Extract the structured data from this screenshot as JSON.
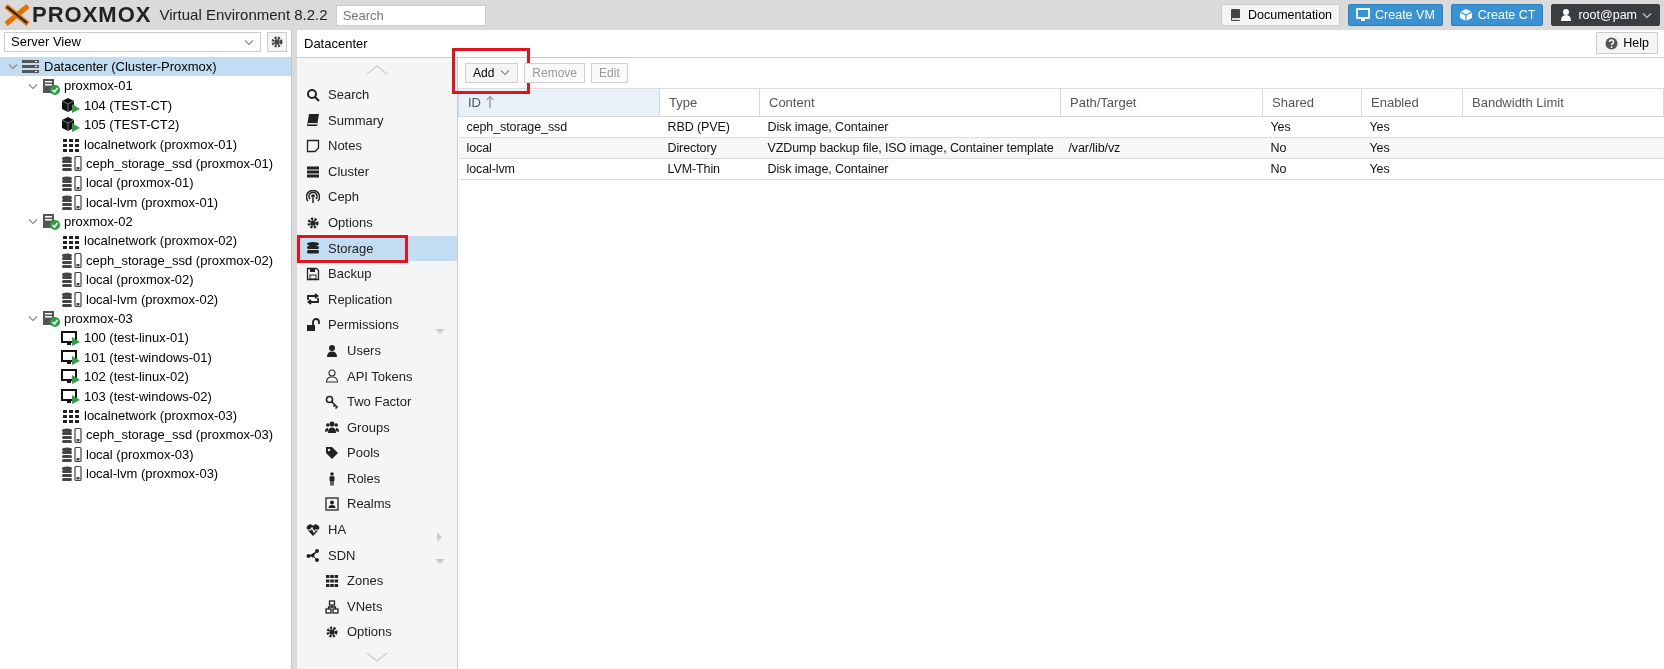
{
  "topbar": {
    "logo": "PROXMOX",
    "product": "Virtual Environment 8.2.2",
    "search": {
      "placeholder": "Search"
    },
    "buttons": [
      {
        "label": "Documentation",
        "kind": "doc"
      },
      {
        "label": "Create VM",
        "kind": "vm"
      },
      {
        "label": "Create CT",
        "kind": "ct"
      },
      {
        "label": "root@pam",
        "kind": "user"
      }
    ]
  },
  "sidebar": {
    "view": "Server View",
    "tree": [
      {
        "label": "Datacenter (Cluster-Proxmox)",
        "kind": "datacenter",
        "selected": true,
        "expanded": true,
        "children": [
          {
            "label": "proxmox-01",
            "kind": "node",
            "selected": false,
            "expanded": true,
            "children": [
              {
                "label": "104 (TEST-CT)",
                "kind": "ct",
                "selected": false
              },
              {
                "label": "105 (TEST-CT2)",
                "kind": "ct",
                "selected": false
              },
              {
                "label": "localnetwork (proxmox-01)",
                "kind": "network",
                "selected": false
              },
              {
                "label": "ceph_storage_ssd (proxmox-01)",
                "kind": "storage",
                "selected": false
              },
              {
                "label": "local (proxmox-01)",
                "kind": "storage",
                "selected": false
              },
              {
                "label": "local-lvm (proxmox-01)",
                "kind": "storage",
                "selected": false
              }
            ]
          },
          {
            "label": "proxmox-02",
            "kind": "node",
            "selected": false,
            "expanded": true,
            "children": [
              {
                "label": "localnetwork (proxmox-02)",
                "kind": "network",
                "selected": false
              },
              {
                "label": "ceph_storage_ssd (proxmox-02)",
                "kind": "storage",
                "selected": false
              },
              {
                "label": "local (proxmox-02)",
                "kind": "storage",
                "selected": false
              },
              {
                "label": "local-lvm (proxmox-02)",
                "kind": "storage",
                "selected": false
              }
            ]
          },
          {
            "label": "proxmox-03",
            "kind": "node",
            "selected": false,
            "expanded": true,
            "children": [
              {
                "label": "100 (test-linux-01)",
                "kind": "vm",
                "selected": false
              },
              {
                "label": "101 (test-windows-01)",
                "kind": "vm",
                "selected": false
              },
              {
                "label": "102 (test-linux-02)",
                "kind": "vm",
                "selected": false
              },
              {
                "label": "103 (test-windows-02)",
                "kind": "vm",
                "selected": false
              },
              {
                "label": "localnetwork (proxmox-03)",
                "kind": "network",
                "selected": false
              },
              {
                "label": "ceph_storage_ssd (proxmox-03)",
                "kind": "storage",
                "selected": false
              },
              {
                "label": "local (proxmox-03)",
                "kind": "storage",
                "selected": false
              },
              {
                "label": "local-lvm (proxmox-03)",
                "kind": "storage",
                "selected": false
              }
            ]
          }
        ]
      }
    ]
  },
  "main": {
    "title": "Datacenter",
    "help": "Help",
    "menu": [
      {
        "label": "Search",
        "selected": false,
        "highlighted": false
      },
      {
        "label": "Summary",
        "selected": false,
        "highlighted": false
      },
      {
        "label": "Notes",
        "selected": false,
        "highlighted": false
      },
      {
        "label": "Cluster",
        "selected": false,
        "highlighted": false
      },
      {
        "label": "Ceph",
        "selected": false,
        "highlighted": false
      },
      {
        "label": "Options",
        "selected": false,
        "highlighted": false
      },
      {
        "label": "Storage",
        "selected": true,
        "highlighted": true
      },
      {
        "label": "Backup",
        "selected": false,
        "highlighted": false
      },
      {
        "label": "Replication",
        "selected": false,
        "highlighted": false
      },
      {
        "label": "Permissions",
        "selected": false,
        "highlighted": false,
        "expanded": true,
        "children": [
          {
            "label": "Users",
            "selected": false,
            "highlighted": false
          },
          {
            "label": "API Tokens",
            "selected": false,
            "highlighted": false
          },
          {
            "label": "Two Factor",
            "selected": false,
            "highlighted": false
          },
          {
            "label": "Groups",
            "selected": false,
            "highlighted": false
          },
          {
            "label": "Pools",
            "selected": false,
            "highlighted": false
          },
          {
            "label": "Roles",
            "selected": false,
            "highlighted": false
          },
          {
            "label": "Realms",
            "selected": false,
            "highlighted": false
          }
        ]
      },
      {
        "label": "HA",
        "selected": false,
        "highlighted": false,
        "expanded": false
      },
      {
        "label": "SDN",
        "selected": false,
        "highlighted": false,
        "expanded": true,
        "children": [
          {
            "label": "Zones",
            "selected": false,
            "highlighted": false
          },
          {
            "label": "VNets",
            "selected": false,
            "highlighted": false
          },
          {
            "label": "Options",
            "selected": false,
            "highlighted": false
          }
        ]
      }
    ],
    "toolbar": [
      {
        "label": "Add",
        "disabled": false,
        "dropdown": true,
        "highlighted": true
      },
      {
        "label": "Remove",
        "disabled": true,
        "dropdown": false,
        "highlighted": false
      },
      {
        "label": "Edit",
        "disabled": true,
        "dropdown": false,
        "highlighted": false
      }
    ],
    "table": {
      "columns": [
        {
          "label": "ID",
          "sorted": true
        },
        {
          "label": "Type",
          "sorted": false
        },
        {
          "label": "Content",
          "sorted": false
        },
        {
          "label": "Path/Target",
          "sorted": false
        },
        {
          "label": "Shared",
          "sorted": false
        },
        {
          "label": "Enabled",
          "sorted": false
        },
        {
          "label": "Bandwidth Limit",
          "sorted": false
        }
      ],
      "rows": [
        [
          "ceph_storage_ssd",
          "RBD (PVE)",
          "Disk image, Container",
          "",
          "Yes",
          "Yes",
          ""
        ],
        [
          "local",
          "Directory",
          "VZDump backup file, ISO image, Container template",
          "/var/lib/vz",
          "No",
          "Yes",
          ""
        ],
        [
          "local-lvm",
          "LVM-Thin",
          "Disk image, Container",
          "",
          "No",
          "Yes",
          ""
        ]
      ]
    }
  }
}
